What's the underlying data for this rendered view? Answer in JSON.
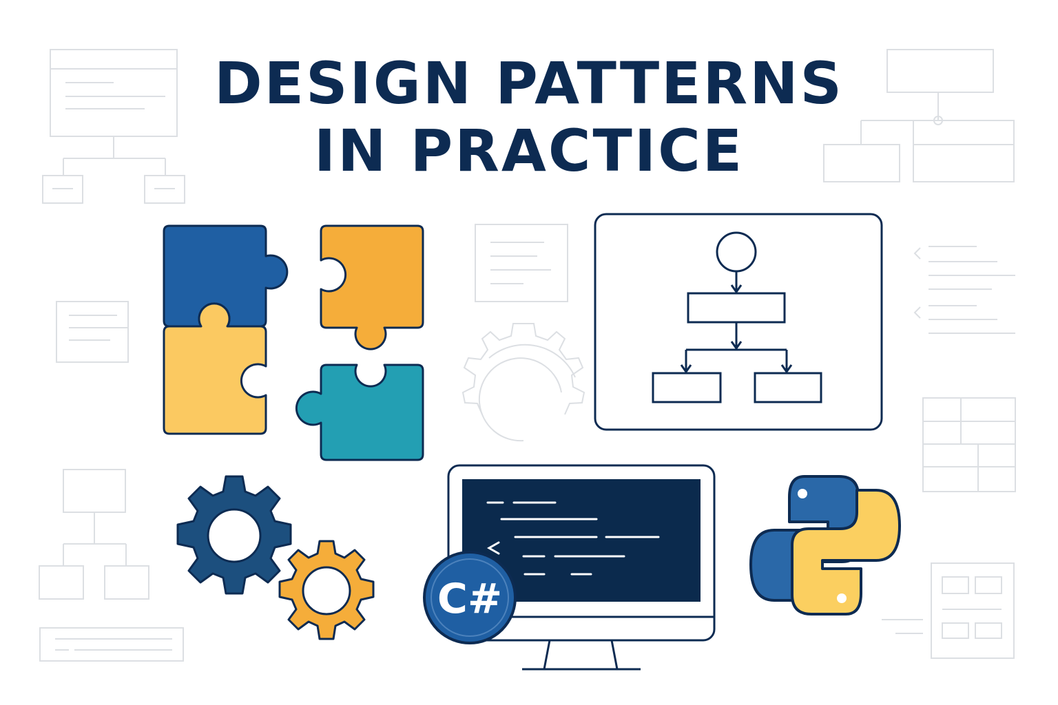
{
  "title": {
    "line1": "DESIGN PATTERNS",
    "line2": "IN PRACTICE"
  },
  "code_badge": {
    "label": "C#"
  },
  "icons": [
    "puzzle-pieces-icon",
    "flowchart-diagram-icon",
    "gears-icon",
    "monitor-code-icon",
    "csharp-logo-icon",
    "python-logo-icon"
  ],
  "colors": {
    "navy": "#0d2b52",
    "blue": "#1f5fa3",
    "dark_blue": "#1c4f7e",
    "orange": "#f5ad3a",
    "yellow": "#fbc961",
    "teal": "#239fb3",
    "screen": "#0b2a4d",
    "light_gray": "#d9dde2",
    "python_blue": "#2a68a8",
    "python_yellow": "#fbcf60"
  }
}
